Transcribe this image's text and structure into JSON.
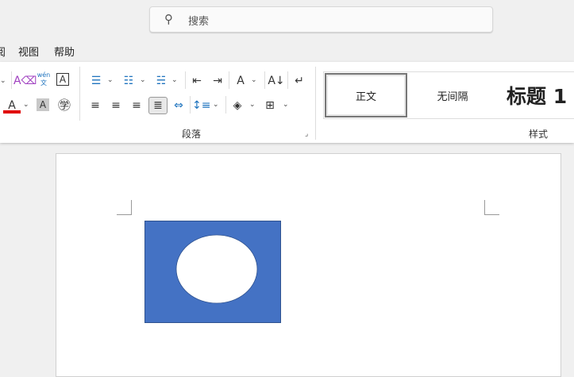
{
  "search": {
    "icon": "search-icon",
    "placeholder": "搜索"
  },
  "menu": {
    "partial": "阅",
    "items": [
      "视图",
      "帮助"
    ]
  },
  "ribbon": {
    "font_tools": [
      "clear-format-icon",
      "phonetic-guide-icon",
      "character-border-icon",
      "font-color-icon",
      "character-shading-icon",
      "enclose-character-icon"
    ],
    "phonetic_label": "wén",
    "phonetic_char": "文",
    "border_char": "A",
    "font_color": "#e00000",
    "paragraph_label": "段落",
    "styles_label": "样式",
    "styles": [
      {
        "label": "正文",
        "selected": true
      },
      {
        "label": "无间隔",
        "selected": false
      },
      {
        "label": "标题 1",
        "selected": false
      }
    ]
  },
  "document": {
    "shape_fill": "#4472c4",
    "ellipse_fill": "#ffffff"
  }
}
